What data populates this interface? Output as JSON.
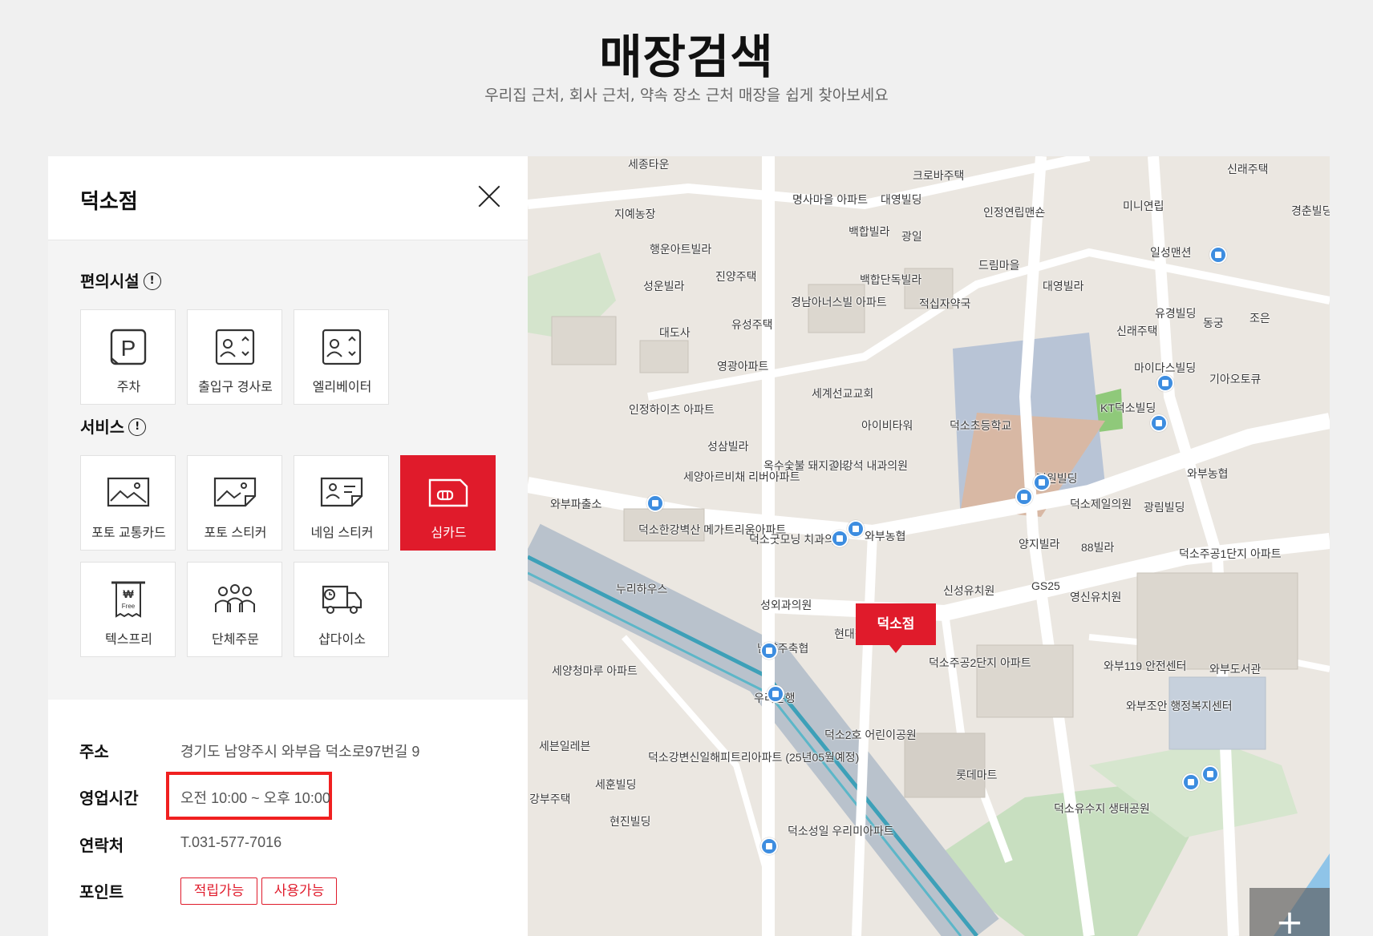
{
  "header": {
    "title": "매장검색",
    "subtitle": "우리집 근처, 회사 근처, 약속 장소 근처 매장을 쉽게 찾아보세요"
  },
  "store": {
    "name": "덕소점",
    "facilities_title": "편의시설",
    "services_title": "서비스",
    "facilities": [
      {
        "label": "주차",
        "icon": "parking-icon"
      },
      {
        "label": "출입구 경사로",
        "icon": "entrance-ramp-icon"
      },
      {
        "label": "엘리베이터",
        "icon": "elevator-icon"
      }
    ],
    "services": [
      {
        "label": "포토 교통카드",
        "icon": "photo-transit-card-icon"
      },
      {
        "label": "포토 스티커",
        "icon": "photo-sticker-icon"
      },
      {
        "label": "네임 스티커",
        "icon": "name-sticker-icon"
      },
      {
        "label": "심카드",
        "icon": "sim-card-icon",
        "active": true
      },
      {
        "label": "텍스프리",
        "icon": "tax-free-icon"
      },
      {
        "label": "단체주문",
        "icon": "group-order-icon"
      },
      {
        "label": "샵다이소",
        "icon": "delivery-truck-icon"
      }
    ],
    "info": {
      "address_label": "주소",
      "address": "경기도 남양주시 와부읍 덕소로97번길 9",
      "hours_label": "영업시간",
      "hours": "오전 10:00 ~ 오후 10:00",
      "phone_label": "연락처",
      "phone": "T.031-577-7016",
      "points_label": "포인트",
      "points": [
        "적립가능",
        "사용가능"
      ]
    }
  },
  "map": {
    "marker_label": "덕소점",
    "zoom_in_label": "+",
    "places": [
      "세종타운",
      "크로바주택",
      "신래주택",
      "명사마을 아파트",
      "대영빌딩",
      "인정연립맨숀",
      "미니연립",
      "경춘빌딩",
      "지예농장",
      "백합빌라",
      "광일",
      "행운아트빌라",
      "드림마을",
      "일성맨션",
      "진양주택",
      "대영빌라",
      "성운빌라",
      "백합단독빌라",
      "경남아너스빌 아파트",
      "적십자약국",
      "유경빌딩",
      "동궁",
      "조은",
      "대도사",
      "유성주택",
      "신래주택",
      "영광아파트",
      "마이다스빌딩",
      "기아오토큐",
      "세계선교교회",
      "KT덕소빌딩",
      "인정하이츠 아파트",
      "아이비타워",
      "덕소초등학교",
      "성삼빌라",
      "옥수숯불 돼지갈비",
      "이강석 내과의원",
      "와부농협",
      "평원빌딩",
      "세양아르비채 리버아파트",
      "와부파출소",
      "덕소제일의원",
      "광림빌딩",
      "덕소한강벽산 메가트리움아파트",
      "덕소굿모닝 치과의원",
      "와부농협",
      "양지빌라",
      "88빌라",
      "덕소주공1단지 아파트",
      "누리하우스",
      "신성유치원",
      "GS25",
      "영신유치원",
      "성외과의원",
      "현대정형 외과의원",
      "남양주축협",
      "덕소주공2단지 아파트",
      "와부119 안전센터",
      "와부도서관",
      "세양청마루 아파트",
      "우리은행",
      "와부조안 행정복지센터",
      "덕소2호 어린이공원",
      "세븐일레븐",
      "덕소강변신일해피트리아파트 (25년05월예정)",
      "롯데마트",
      "세훈빌딩",
      "강부주택",
      "덕소유수지 생태공원",
      "현진빌딩",
      "덕소성일 우리미아파트"
    ]
  }
}
